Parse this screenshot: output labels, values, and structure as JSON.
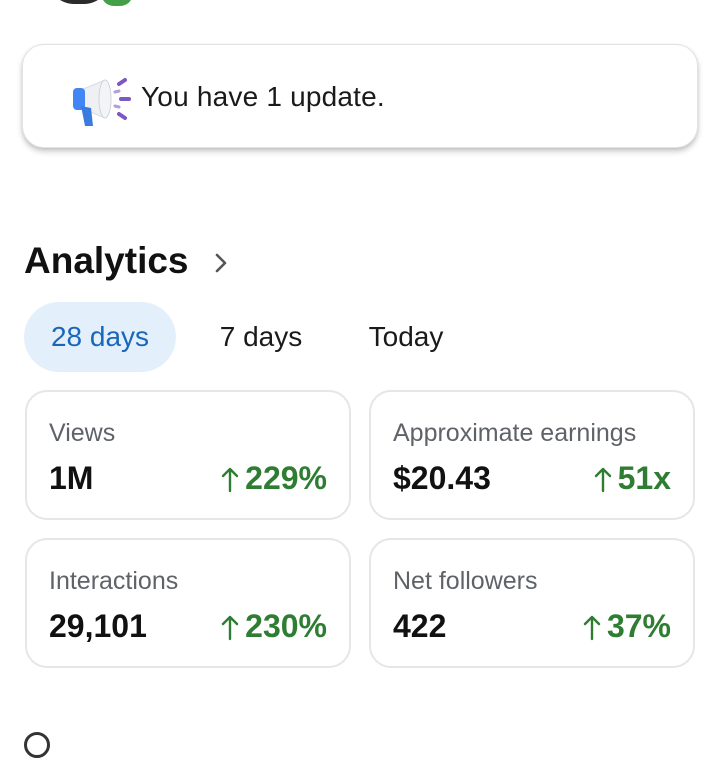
{
  "notification": {
    "text": "You have 1 update."
  },
  "analytics": {
    "title": "Analytics",
    "tabs": [
      {
        "label": "28 days",
        "selected": true
      },
      {
        "label": "7 days",
        "selected": false
      },
      {
        "label": "Today",
        "selected": false
      }
    ],
    "stats": [
      {
        "label": "Views",
        "value": "1M",
        "change": "229%"
      },
      {
        "label": "Approximate earnings",
        "value": "$20.43",
        "change": "51x"
      },
      {
        "label": "Interactions",
        "value": "29,101",
        "change": "230%"
      },
      {
        "label": "Net followers",
        "value": "422",
        "change": "37%"
      }
    ]
  },
  "colors": {
    "accent_blue": "#1a66b8",
    "selected_tab_bg": "#e3f0fc",
    "positive_green": "#2e7d32",
    "megaphone_blue": "#4285f4",
    "megaphone_purple": "#7e57c2"
  },
  "icons": {
    "notification": "megaphone-icon",
    "section_link": "chevron-right-icon",
    "trend": "arrow-up-icon"
  }
}
